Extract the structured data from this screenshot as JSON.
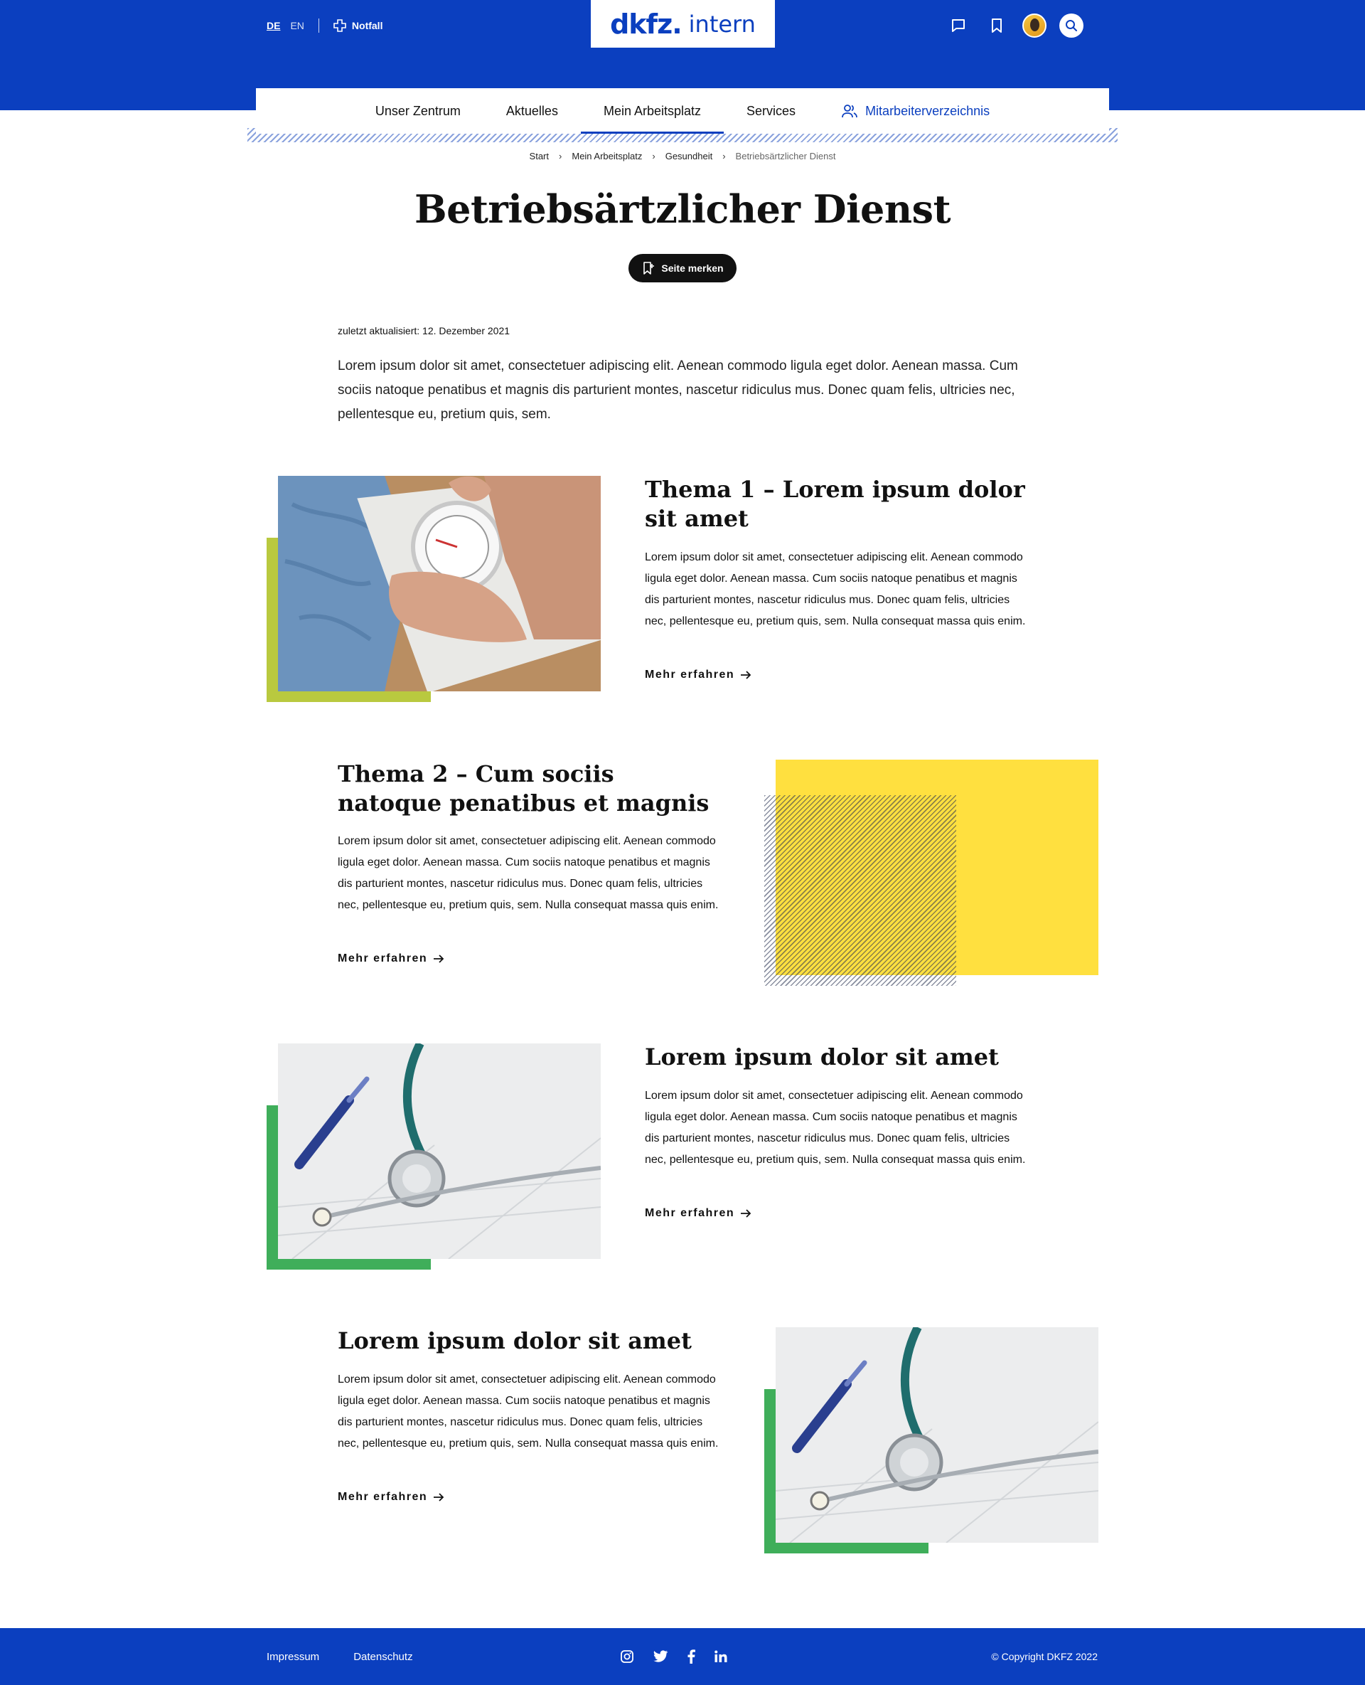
{
  "header": {
    "lang_active": "DE",
    "lang_other": "EN",
    "emergency_label": "Notfall",
    "logo_brand": "dkfz.",
    "logo_sub": "intern"
  },
  "nav": {
    "items": [
      "Unser Zentrum",
      "Aktuelles",
      "Mein Arbeitsplatz",
      "Services"
    ],
    "directory_label": "Mitarbeiterverzeichnis",
    "active": "Mein Arbeitsplatz"
  },
  "breadcrumb": [
    "Start",
    "Mein Arbeitsplatz",
    "Gesundheit",
    "Betriebsärtzlicher Dienst"
  ],
  "page": {
    "title": "Betriebsärtzlicher Dienst",
    "bookmark_label": "Seite merken",
    "updated": "zuletzt aktualisiert: 12. Dezember 2021",
    "intro": "Lorem ipsum dolor sit amet, consectetuer adipiscing elit. Aenean commodo ligula eget dolor. Aenean massa. Cum sociis natoque penatibus et magnis dis parturient montes, nascetur ridiculus mus. Donec quam felis, ultricies nec, pellentesque eu, pretium quis, sem."
  },
  "sections": [
    {
      "title": "Thema 1 – Lorem ipsum dolor sit amet",
      "text": "Lorem ipsum dolor sit amet, consectetuer adipiscing elit. Aenean commodo ligula eget dolor. Aenean massa. Cum sociis natoque penatibus et magnis dis parturient montes, nascetur ridiculus mus. Donec quam felis, ultricies nec, pellentesque eu, pretium quis, sem. Nulla consequat massa quis enim.",
      "more": "Mehr erfahren",
      "accent": "#b9c93f"
    },
    {
      "title": "Thema 2 – Cum sociis natoque penatibus et magnis",
      "text": "Lorem ipsum dolor sit amet, consectetuer adipiscing elit. Aenean commodo ligula eget dolor. Aenean massa. Cum sociis natoque penatibus et magnis dis parturient montes, nascetur ridiculus mus. Donec quam felis, ultricies nec, pellentesque eu, pretium quis, sem. Nulla consequat massa quis enim.",
      "more": "Mehr erfahren",
      "accent": "#ffe03f"
    },
    {
      "title": "Lorem ipsum dolor sit amet",
      "text": "Lorem ipsum dolor sit amet, consectetuer adipiscing elit. Aenean commodo ligula eget dolor. Aenean massa. Cum sociis natoque penatibus et magnis dis parturient montes, nascetur ridiculus mus. Donec quam felis, ultricies nec, pellentesque eu, pretium quis, sem. Nulla consequat massa quis enim.",
      "more": "Mehr erfahren",
      "accent": "#3fae5a"
    },
    {
      "title": "Lorem ipsum dolor sit amet",
      "text": "Lorem ipsum dolor sit amet, consectetuer adipiscing elit. Aenean commodo ligula eget dolor. Aenean massa. Cum sociis natoque penatibus et magnis dis parturient montes, nascetur ridiculus mus. Donec quam felis, ultricies nec, pellentesque eu, pretium quis, sem. Nulla consequat massa quis enim.",
      "more": "Mehr erfahren",
      "accent": "#3fae5a"
    }
  ],
  "footer": {
    "links": [
      "Impressum",
      "Datenschutz"
    ],
    "social": [
      "instagram-icon",
      "twitter-icon",
      "facebook-icon",
      "linkedin-icon"
    ],
    "copyright": "© Copyright DKFZ 2022"
  },
  "colors": {
    "brand_blue": "#0b3fbf",
    "dark_button": "#111111"
  }
}
